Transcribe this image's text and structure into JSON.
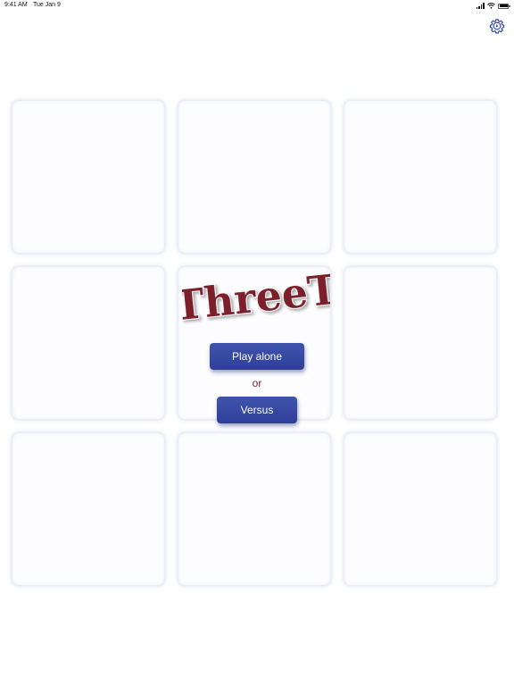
{
  "status_bar": {
    "time": "9:41 AM",
    "date": "Tue Jan 9"
  },
  "logo": {
    "text": "ThreeT",
    "color": "#7b1f2b"
  },
  "menu": {
    "play_alone_label": "Play alone",
    "or_label": "or",
    "versus_label": "Versus"
  },
  "icons": {
    "settings": "gear-icon",
    "signal": "signal-bars-icon",
    "wifi": "wifi-icon",
    "battery": "battery-icon"
  },
  "colors": {
    "button": "#3447a4",
    "accent": "#3447a4",
    "logo": "#7b1f2b",
    "tile_border": "#e6eaf5"
  },
  "board": {
    "rows": 3,
    "cols": 3
  }
}
